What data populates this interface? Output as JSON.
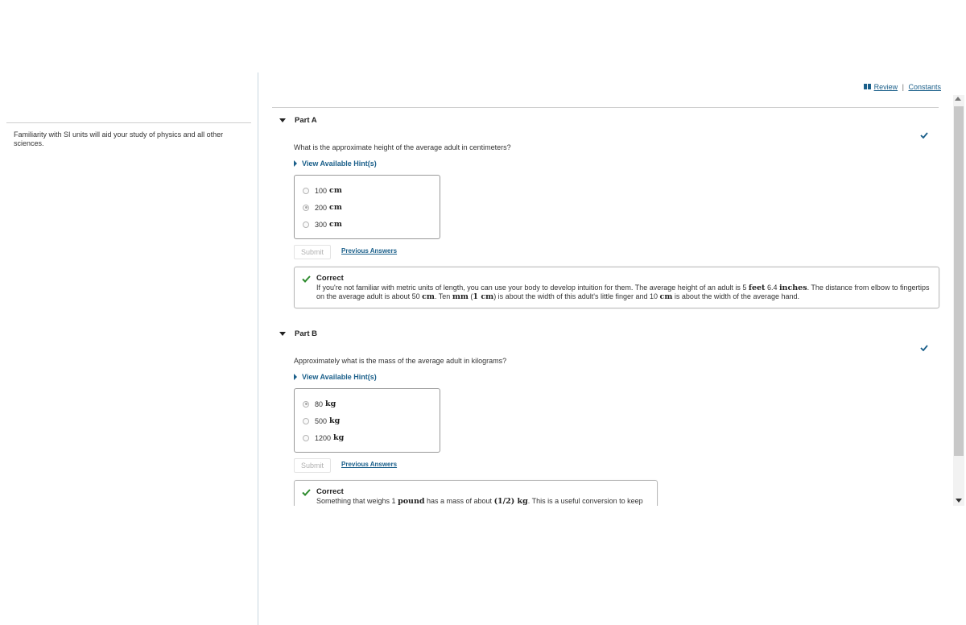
{
  "intro": {
    "text": "Familiarity with SI units will aid your study of physics and all other sciences."
  },
  "toolbar": {
    "review_label": "Review",
    "separator": "|",
    "constants_label": "Constants"
  },
  "part_a": {
    "title": "Part A",
    "question": "What is the approximate height of the average adult in centimeters?",
    "hint_label": "View Available Hint(s)",
    "options": [
      {
        "value": "100",
        "unit": "cm",
        "selected": false
      },
      {
        "value": "200",
        "unit": "cm",
        "selected": true
      },
      {
        "value": "300",
        "unit": "cm",
        "selected": false
      }
    ],
    "submit_label": "Submit",
    "previous_answers_label": "Previous Answers",
    "feedback": {
      "title": "Correct",
      "t1": "If you're not familiar with metric units of length, you can use your body to develop intuition for them. The average height of an adult is 5 ",
      "m1": "feet",
      "t2": " 6.4 ",
      "m2": "inches",
      "t3": ". The distance from elbow to fingertips on the average adult is about 50 ",
      "m3": "cm",
      "t4": ". Ten ",
      "m4": "mm",
      "t5": " (",
      "m5": "1 cm",
      "t6": ") is about the width of this adult's little finger and 10 ",
      "m6": "cm",
      "t7": " is about the width of the average hand."
    }
  },
  "part_b": {
    "title": "Part B",
    "question": "Approximately what is the mass of the average adult in kilograms?",
    "hint_label": "View Available Hint(s)",
    "options": [
      {
        "value": "80",
        "unit": "kg",
        "selected": true
      },
      {
        "value": "500",
        "unit": "kg",
        "selected": false
      },
      {
        "value": "1200",
        "unit": "kg",
        "selected": false
      }
    ],
    "submit_label": "Submit",
    "previous_answers_label": "Previous Answers",
    "feedback": {
      "title": "Correct",
      "t1": "Something that weighs 1 ",
      "m1": "pound",
      "t2": " has a mass of about ",
      "m2": "(1/2) kg",
      "t3": ". This is a useful conversion to keep in mind!"
    }
  },
  "colors": {
    "link": "#1a5f8a",
    "correct_green": "#2e8b2e",
    "status_check": "#1a5f8a"
  }
}
